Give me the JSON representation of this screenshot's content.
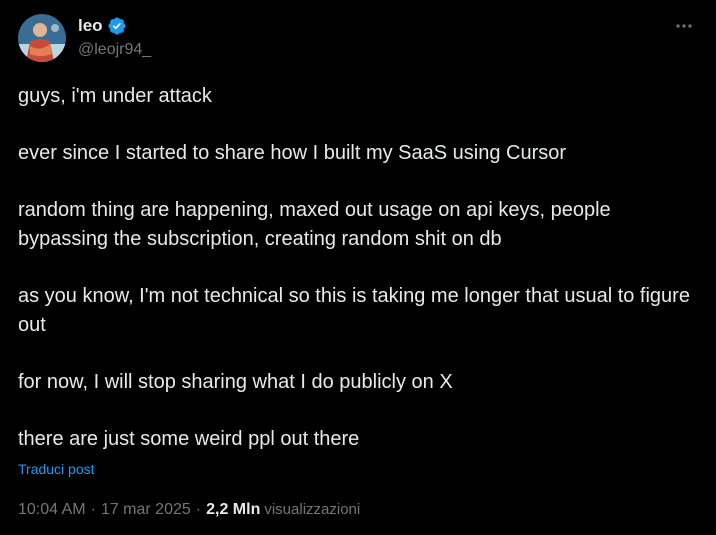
{
  "author": {
    "display_name": "leo",
    "handle": "@leojr94_",
    "verified": true,
    "verified_color": "#1d9bf0"
  },
  "tweet": {
    "paragraphs": [
      "guys, i'm under attack",
      "ever since I started to share how I built my SaaS using Cursor",
      "random thing are happening, maxed out usage on api keys, people bypassing the subscription, creating random shit on db",
      "as you know, I'm not technical so this is taking me longer that usual to figure out",
      "for now, I will stop sharing what I do publicly on X",
      "there are just some weird ppl out there"
    ],
    "translate_label": "Traduci post"
  },
  "meta": {
    "time": "10:04 AM",
    "separator": "·",
    "date": "17 mar 2025",
    "views_count": "2,2 Mln",
    "views_label": "visualizzazioni"
  },
  "icons": {
    "more": "more-horizontal-icon",
    "verified": "verified-badge-icon"
  },
  "colors": {
    "background": "#000000",
    "text_primary": "#e7e9ea",
    "text_secondary": "#71767b",
    "accent": "#1d9bf0"
  }
}
